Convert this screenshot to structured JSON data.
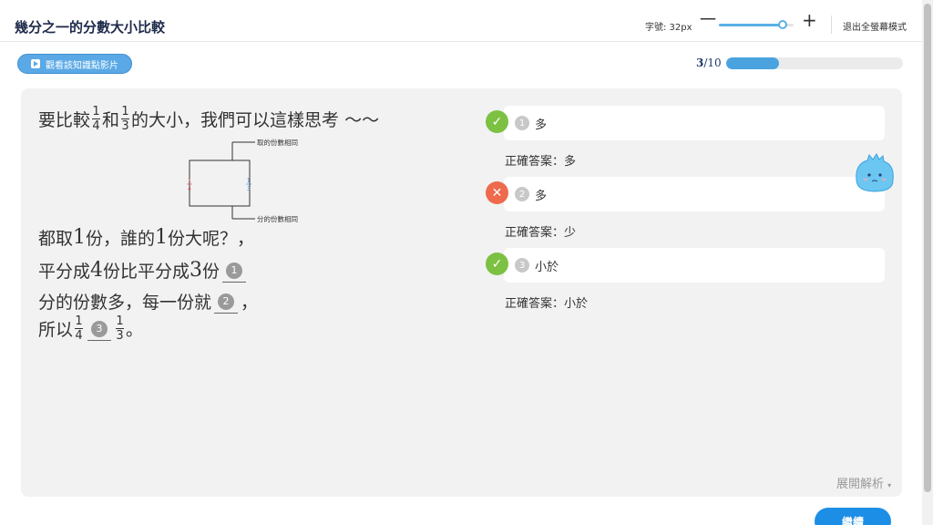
{
  "app": {
    "title": "幾分之一的分數大小比較"
  },
  "toolbar": {
    "font_size_label": "字號: 32px",
    "font_slider_value": 0.85,
    "decrease_label": "一",
    "increase_label": "+",
    "exit_fullscreen_label": "退出全螢幕模式"
  },
  "video": {
    "label": "觀看該知識點影片"
  },
  "progress": {
    "current": "3",
    "total": "/10",
    "fraction": 0.3
  },
  "question": {
    "line1_prefix": "要比較",
    "frac_a_num": "1",
    "frac_a_den": "4",
    "line1_and": "和",
    "frac_b_num": "1",
    "frac_b_den": "3",
    "line1_suffix": "的大小，我們可以這樣思考 ～～",
    "diagram_top_label": "取的份數相同",
    "diagram_bottom_label": "分的份數相同",
    "line2_a": "都取",
    "line2_b": "1",
    "line2_c": "份，誰的",
    "line2_d": "1",
    "line2_e": "份大呢？，",
    "line3_a": "平分成",
    "line3_b": "4",
    "line3_c": "份比平分成",
    "line3_d": "3",
    "line3_e": "份",
    "blank1": "1",
    "line4_a": "分的份數多，每一份就",
    "blank2": "2",
    "line4_b": "，",
    "line5_a": "所以",
    "blank3": "3",
    "line5_end": "。"
  },
  "answers": [
    {
      "num": "1",
      "value": "多",
      "status": "correct",
      "correct_label": "正確答案：多"
    },
    {
      "num": "2",
      "value": "多",
      "status": "wrong",
      "correct_label": "正確答案：少"
    },
    {
      "num": "3",
      "value": "小於",
      "status": "correct",
      "correct_label": "正確答案：小於"
    }
  ],
  "footer": {
    "expand_label": "展開解析",
    "continue_label": "繼續"
  },
  "colors": {
    "accent": "#1d8ee6",
    "correct": "#7cc142",
    "wrong": "#ee6a4d"
  }
}
